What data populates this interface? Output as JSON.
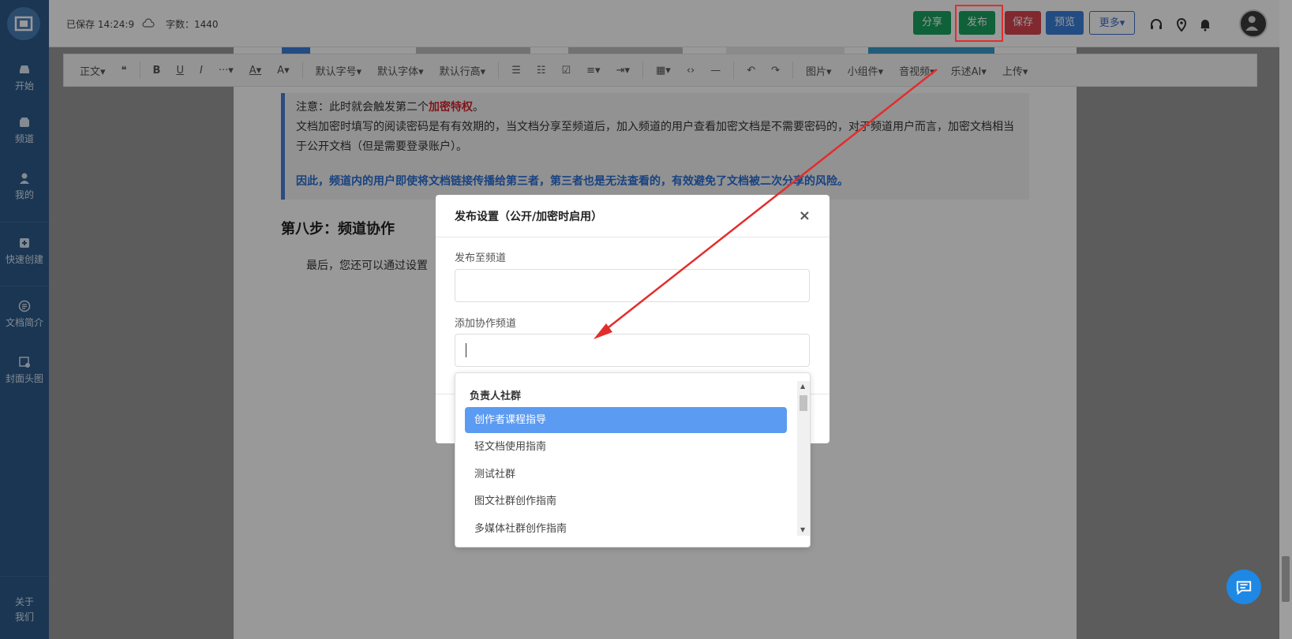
{
  "sidebar": {
    "items": [
      {
        "label": "开始",
        "icon": "inbox-icon"
      },
      {
        "label": "频道",
        "icon": "channel-icon"
      },
      {
        "label": "我的",
        "icon": "user-icon"
      },
      {
        "label": "快速创建",
        "icon": "quick-create-icon"
      },
      {
        "label": "文档简介",
        "icon": "doc-intro-icon"
      },
      {
        "label": "封面头图",
        "icon": "cover-image-icon"
      }
    ],
    "about": "关于我们"
  },
  "topbar": {
    "saved": "已保存 14:24:9",
    "wordcount": "字数：1440",
    "buttons": {
      "share": "分享",
      "publish": "发布",
      "save": "保存",
      "preview": "预览",
      "more": "更多▾"
    }
  },
  "toolbar": {
    "items": [
      "正文▾",
      "❝",
      "B",
      "U",
      "I",
      "···▾",
      "A▾",
      "A▾",
      "默认字号▾",
      "默认字体▾",
      "默认行高▾",
      "☰",
      "☷",
      "☑",
      "≡▾",
      "⇥▾",
      "▦▾",
      "‹›",
      "—",
      "↶",
      "↷",
      "图片▾",
      "小组件▾",
      "音视频▾",
      "乐述AI▾",
      "上传▾"
    ]
  },
  "content": {
    "note_line1_prefix": "注意：此时就会触发第二个",
    "note_line1_highlight": "加密特权",
    "note_line1_suffix": "。",
    "note_line2": "文档加密时填写的阅读密码是有有效期的，当文档分享至频道后，加入频道的用户查看加密文档是不需要密码的，对于频道用户而言，加密文档相当于公开文档（但是需要登录账户）。",
    "note_line3": "因此，频道内的用户即使将文档链接传播给第三者，第三者也是无法查看的，有效避免了文档被二次分享的风险。",
    "step_title": "第八步：频道协作",
    "para": "最后，您还可以通过设置"
  },
  "modal": {
    "title": "发布设置（公开/加密时启用）",
    "close": "×",
    "field1_label": "发布至频道",
    "field2_label": "添加协作频道"
  },
  "dropdown": {
    "group": "负责人社群",
    "items": [
      "创作者课程指导",
      "轻文档使用指南",
      "测试社群",
      "图文社群创作指南",
      "多媒体社群创作指南"
    ],
    "active_index": 0
  },
  "colors": {
    "sidebar": "#2c5a8a",
    "green": "#1aa260",
    "red": "#d9434f",
    "blue": "#3b7fd9",
    "highlight": "#e32d2d",
    "active_item": "#5b9bf2"
  }
}
